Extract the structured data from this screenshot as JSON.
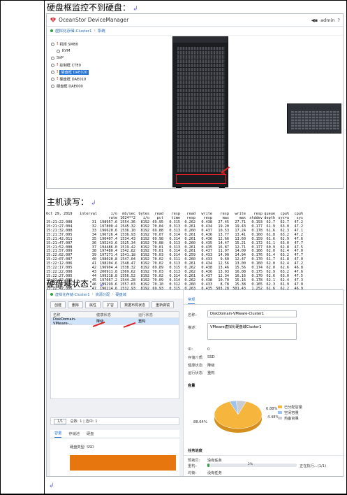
{
  "doc": {
    "heading1": "硬盘框监控不到硬盘：",
    "heading2": "主机读写：",
    "heading3": "硬盘域状态：",
    "para_mark": "↲"
  },
  "device_manager": {
    "app_title": "OceanStor DeviceManager",
    "toolbar_right": {
      "sound": "◀▪",
      "user": "admin",
      "help": "?"
    },
    "breadcrumb": {
      "system": "虚拟化存储-Cluster1",
      "current": "系统"
    },
    "tree": [
      {
        "label": "机柜 SMB0",
        "warn": true,
        "selected": false,
        "indent": 0
      },
      {
        "label": "KVM",
        "warn": false,
        "selected": false,
        "indent": 1
      },
      {
        "label": "SVP",
        "warn": false,
        "selected": false,
        "indent": 0
      },
      {
        "label": "控制框 CTE0",
        "warn": true,
        "selected": false,
        "indent": 0
      },
      {
        "label": "硬盘框 DAE020",
        "warn": true,
        "selected": true,
        "indent": 0
      },
      {
        "label": "硬盘框 DAE010",
        "warn": true,
        "selected": false,
        "indent": 0
      },
      {
        "label": "硬盘框 DAE000",
        "warn": false,
        "selected": false,
        "indent": 0
      }
    ]
  },
  "console": {
    "header1": [
      "Oct 29, 2019",
      "interval",
      "i/o",
      "mb/sec",
      "bytes",
      "read",
      "resp",
      "read",
      "write",
      "resp",
      "write",
      "resp",
      "queue",
      "cpu%",
      "cpu%"
    ],
    "header2": [
      "",
      "",
      "rate",
      "1024**2",
      "i/o",
      "pct",
      "time",
      "resp",
      "resp",
      "max",
      "max",
      "stddev",
      "depth",
      "sys+u",
      "sys"
    ],
    "rows": [
      [
        "15:21:22.008",
        "31",
        "198957.6",
        "1554.36",
        "8192",
        "69.95",
        "0.315",
        "0.262",
        "0.438",
        "27.45",
        "27.71",
        "0.193",
        "62.7",
        "62.7",
        "47.2"
      ],
      [
        "15:21:27.004",
        "32",
        "197800.4",
        "1545.32",
        "8192",
        "70.04",
        "0.313",
        "0.261",
        "0.434",
        "19.20",
        "19.43",
        "0.177",
        "61.9",
        "63.0",
        "47.2"
      ],
      [
        "15:21:32.008",
        "33",
        "196620.6",
        "1536.10",
        "8192",
        "69.88",
        "0.313",
        "0.260",
        "0.437",
        "10.53",
        "17.24",
        "0.178",
        "61.6",
        "62.3",
        "47.1"
      ],
      [
        "15:21:37.005",
        "34",
        "196726.4",
        "1536.93",
        "8192",
        "70.07",
        "0.314",
        "0.261",
        "0.436",
        "13.77",
        "13.41",
        "0.160",
        "61.8",
        "63.2",
        "47.2"
      ],
      [
        "15:21:42.011",
        "35",
        "196407.4",
        "1534.43",
        "8192",
        "69.98",
        "0.314",
        "0.261",
        "0.436",
        "12.66",
        "13.60",
        "0.159",
        "61.6",
        "62.9",
        "47.6"
      ],
      [
        "15:21:47.007",
        "36",
        "195243.6",
        "1525.34",
        "8192",
        "70.08",
        "0.313",
        "0.260",
        "0.435",
        "14.47",
        "15.21",
        "0.172",
        "61.1",
        "63.0",
        "47.7"
      ],
      [
        "15:21:52.008",
        "37",
        "194486.0",
        "1519.42",
        "8192",
        "70.01",
        "0.313",
        "0.261",
        "0.435",
        "16.87",
        "12.71",
        "0.177",
        "60.9",
        "62.8",
        "47.5"
      ],
      [
        "15:21:57.009",
        "38",
        "197480.4",
        "1542.82",
        "8192",
        "70.01",
        "0.314",
        "0.261",
        "0.437",
        "11.97",
        "14.09",
        "0.166",
        "62.0",
        "62.4",
        "47.0"
      ],
      [
        "15:22:02.007",
        "39",
        "197271.4",
        "1541.18",
        "8192",
        "70.03",
        "0.314",
        "0.259",
        "0.433",
        "14.90",
        "14.94",
        "0.176",
        "61.4",
        "63.2",
        "47.7"
      ],
      [
        "15:22:07.007",
        "40",
        "198020.8",
        "1547.04",
        "8192",
        "70.02",
        "0.311",
        "0.260",
        "0.433",
        "9.60",
        "12.47",
        "0.170",
        "61.7",
        "61.8",
        "47.0"
      ],
      [
        "15:22:12.006",
        "41",
        "198204.6",
        "1548.47",
        "8192",
        "70.02",
        "0.313",
        "0.261",
        "0.434",
        "12.56",
        "13.00",
        "0.160",
        "62.0",
        "62.4",
        "47.2"
      ],
      [
        "15:22:17.005",
        "42",
        "196904.4",
        "1538.32",
        "8192",
        "69.89",
        "0.315",
        "0.262",
        "0.438",
        "13.46",
        "15.56",
        "0.174",
        "62.0",
        "62.6",
        "46.8"
      ],
      [
        "15:22:22.008",
        "43",
        "200911.8",
        "1569.62",
        "8192",
        "70.03",
        "0.313",
        "0.262",
        "0.436",
        "13.93",
        "16.08",
        "0.175",
        "62.9",
        "63.2",
        "47.6"
      ],
      [
        "15:22:27.005",
        "44",
        "199218.8",
        "1556.52",
        "8192",
        "70.02",
        "0.314",
        "0.261",
        "0.437",
        "12.34",
        "16.16",
        "0.170",
        "62.6",
        "63.0",
        "47.5"
      ],
      [
        "15:22:32.005",
        "45",
        "197667.2",
        "1544.28",
        "8192",
        "70.09",
        "0.314",
        "0.262",
        "0.438",
        "10.70",
        "15.16",
        "0.178",
        "62.1",
        "62.4",
        "47.3"
      ],
      [
        "15:22:37.005",
        "46",
        "199299.6",
        "1557.03",
        "8192",
        "70.10",
        "0.312",
        "0.260",
        "0.433",
        "8.78",
        "15.38",
        "0.165",
        "62.3",
        "61.9",
        "47.0"
      ],
      [
        "15:22:42.006",
        "47",
        "196214.6",
        "1532.93",
        "8192",
        "69.93",
        "0.315",
        "0.263",
        "0.435",
        "503.28",
        "501.43",
        "1.252",
        "61.6",
        "62.2",
        "46.9"
      ]
    ]
  },
  "disk_domain": {
    "breadcrumb": {
      "system": "虚拟化存储-Cluster1",
      "mid": "资源分配",
      "current": "硬盘域"
    },
    "toolbar": [
      "创建",
      "删除",
      "属性",
      "扩容",
      "数据布局状态",
      "重新做镜"
    ],
    "columns": [
      "名称",
      "健康状态",
      "运行状态"
    ],
    "row": {
      "name": "DiskDomain-VMware-...",
      "health": "降级",
      "running": "重构"
    },
    "pager": {
      "page": "1/1",
      "total": "总数: 1 | 选中: 1"
    },
    "bottom_tabs": [
      "容量",
      "存储池",
      "硬盘"
    ],
    "disk_type_label": "硬盘类型:",
    "disk_type_value": "SSD",
    "detail": {
      "tab": "常规",
      "name_label": "名称:",
      "name_value": "DiskDomain-VMware-Cluster1",
      "desc_label": "描述:",
      "desc_value": "VMware虚拟化硬盘域Cluster1",
      "id_label": "ID:",
      "id_value": "0",
      "medium_label": "存储介质:",
      "medium_value": "SSD",
      "health_label": "健康状态:",
      "health_value": "降级",
      "running_label": "运行状态:",
      "running_value": "重构",
      "capacity_title": "容量",
      "pie": {
        "used": 88.64,
        "free": 4.48,
        "hotspare": 6.88
      },
      "pie_labels": {
        "used": "88.64%",
        "free": "4.48%",
        "hotspare": "6.88%"
      },
      "legend": [
        "已分配容量",
        "空闲容量",
        "热备容量"
      ],
      "legend_colors": [
        "#f6b53c",
        "#9cc4ef",
        "#c9cdd2"
      ],
      "task_title": "任务进度",
      "task_rows": [
        {
          "label": "预拷贝:",
          "value": "没有任务"
        },
        {
          "label": "重构:",
          "value": "2%",
          "status": "正在执行...(1/1)",
          "progress": 0.02
        },
        {
          "label": "均衡:",
          "value": "没有任务"
        }
      ]
    }
  }
}
